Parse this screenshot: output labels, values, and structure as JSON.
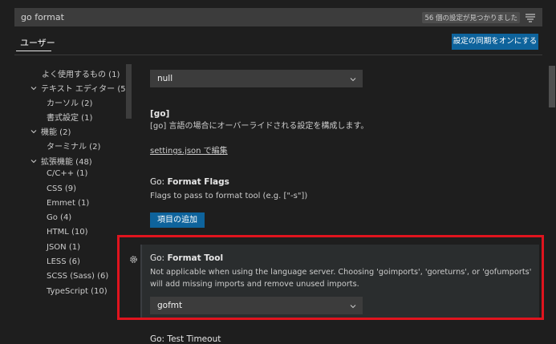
{
  "search": {
    "value": "go format",
    "result_badge": "56 個の設定が見つかりました",
    "filter_icon": "filter-icon"
  },
  "header": {
    "tab_user": "ユーザー",
    "sync_button": "設定の同期をオンにする"
  },
  "toc": [
    {
      "label": "よく使用するもの (1)",
      "chevron": false
    },
    {
      "label": "テキスト エディター (5)",
      "chevron": true
    },
    {
      "label": "カーソル (2)",
      "chevron": false
    },
    {
      "label": "書式設定 (1)",
      "chevron": false
    },
    {
      "label": "機能 (2)",
      "chevron": true
    },
    {
      "label": "ターミナル (2)",
      "chevron": false
    },
    {
      "label": "拡張機能 (48)",
      "chevron": true
    },
    {
      "label": "C/C++ (1)",
      "chevron": false
    },
    {
      "label": "CSS (9)",
      "chevron": false
    },
    {
      "label": "Emmet (1)",
      "chevron": false
    },
    {
      "label": "Go (4)",
      "chevron": false
    },
    {
      "label": "HTML (10)",
      "chevron": false
    },
    {
      "label": "JSON (1)",
      "chevron": false
    },
    {
      "label": "LESS (6)",
      "chevron": false
    },
    {
      "label": "SCSS (Sass) (6)",
      "chevron": false
    },
    {
      "label": "TypeScript (10)",
      "chevron": false
    }
  ],
  "settings": {
    "top_dropdown": {
      "value": "null"
    },
    "go": {
      "title": "[go]",
      "description": "[go] 言語の場合にオーバーライドされる設定を構成します。",
      "link": "settings.json で編集"
    },
    "format_flags": {
      "title_prefix": "Go: ",
      "title": "Format Flags",
      "description": "Flags to pass to format tool (e.g. [\"-s\"])",
      "button": "項目の追加"
    },
    "format_tool": {
      "title_prefix": "Go: ",
      "title": "Format Tool",
      "description_line1": "Not applicable when using the language server. Choosing 'goimports', 'goreturns', or 'gofumports'",
      "description_line2": "will add missing imports and remove unused imports.",
      "value": "gofmt"
    },
    "next": {
      "title": "Go: Test Timeout"
    }
  },
  "colors": {
    "accent": "#0e639c",
    "highlight_border": "#e0141e",
    "background": "#1e1e1e"
  }
}
